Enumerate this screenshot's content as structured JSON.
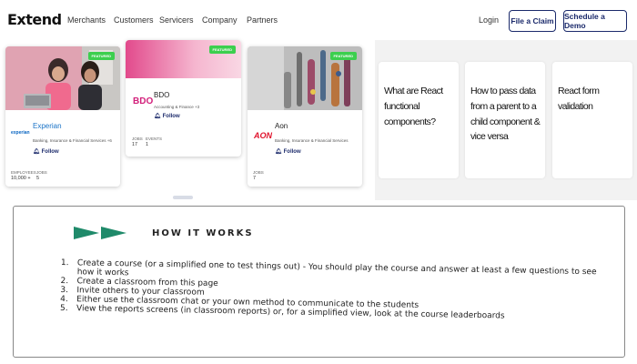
{
  "nav": {
    "logo": "Extend",
    "links": [
      "Merchants",
      "Customers",
      "Servicers",
      "Company",
      "Partners"
    ],
    "login": "Login",
    "file_claim": "File a Claim",
    "schedule_demo": "Schedule a Demo"
  },
  "companies": [
    {
      "badge": "FEATURED",
      "logo": "experian",
      "name": "Experian",
      "sub": "Banking, Insurance & Financial Services +6",
      "follow": "Follow",
      "stats": [
        {
          "label": "EMPLOYEES",
          "value": "10,000 +"
        },
        {
          "label": "JOBS",
          "value": "5"
        }
      ]
    },
    {
      "badge": "FEATURED",
      "logo": "BDO",
      "name": "BDO",
      "sub": "Accounting & Finance +3",
      "follow": "Follow",
      "stats": [
        {
          "label": "JOBS",
          "value": "17"
        },
        {
          "label": "EVENTS",
          "value": "1"
        }
      ]
    },
    {
      "badge": "FEATURED",
      "logo": "AON",
      "name": "Aon",
      "sub": "Banking, Insurance & Financial Services",
      "follow": "Follow",
      "stats": [
        {
          "label": "JOBS",
          "value": "7"
        }
      ]
    }
  ],
  "articles": [
    "What are React functional components?",
    "How to pass data from a parent to a child component & vice versa",
    "React form validation"
  ],
  "how_it_works": {
    "title": "HOW IT WORKS",
    "steps": [
      {
        "num": "1.",
        "text": "Create a course (or a simplified one to test things out) - You should play the course and answer at least a few questions to see how it works"
      },
      {
        "num": "2.",
        "text": "Create a classroom from this page"
      },
      {
        "num": "3.",
        "text": "Invite others to your classroom"
      },
      {
        "num": "4.",
        "text": "Either use the classroom chat or your own method to communicate to the students"
      },
      {
        "num": "5.",
        "text": "View the reports screens (in classroom reports) or, for a simplified view, look at the course leaderboards"
      }
    ]
  },
  "colors": {
    "brand_navy": "#1b2a6b",
    "featured_green": "#3ccf4e",
    "arrow_green": "#1f8a6a",
    "experian_blue": "#0a66c2",
    "bdo_pink": "#d21f7a",
    "aon_red": "#e0112b"
  }
}
